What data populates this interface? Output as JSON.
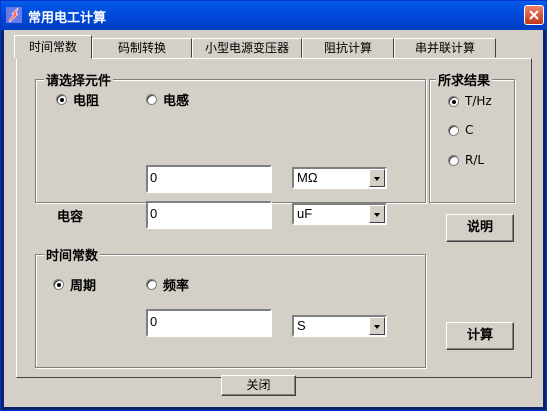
{
  "window": {
    "title": "常用电工计算"
  },
  "tabs": [
    {
      "label": "时间常数",
      "active": true
    },
    {
      "label": "码制转换"
    },
    {
      "label": "小型电源变压器"
    },
    {
      "label": "阻抗计算"
    },
    {
      "label": "串并联计算"
    }
  ],
  "component_group": {
    "title": "请选择元件",
    "options": [
      {
        "label": "电阻",
        "selected": true
      },
      {
        "label": "电感",
        "selected": false
      }
    ],
    "value": "0",
    "unit": "MΩ"
  },
  "result_group": {
    "title": "所求结果",
    "options": [
      {
        "label": "T/Hz",
        "selected": true
      },
      {
        "label": "C",
        "selected": false
      },
      {
        "label": "R/L",
        "selected": false
      }
    ]
  },
  "capacitor": {
    "label": "电容",
    "value": "0",
    "unit": "uF"
  },
  "time_group": {
    "title": "时间常数",
    "options": [
      {
        "label": "周期",
        "selected": true
      },
      {
        "label": "频率",
        "selected": false
      }
    ],
    "value": "0",
    "unit": "S"
  },
  "buttons": {
    "help": "说明",
    "calculate": "计算",
    "close": "关闭"
  }
}
